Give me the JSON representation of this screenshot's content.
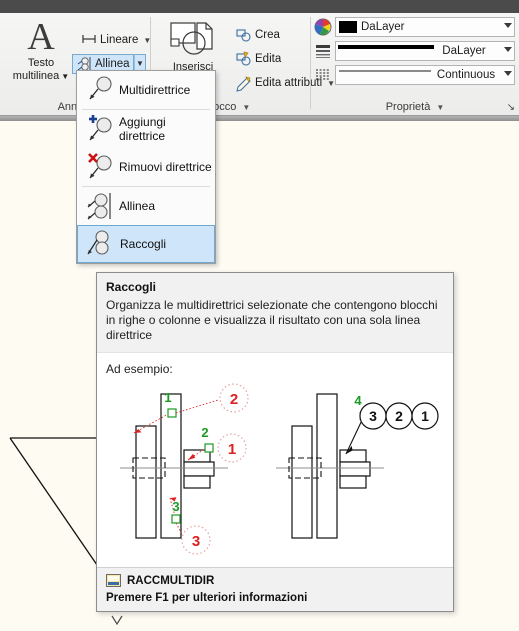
{
  "window": {
    "titlebar_color": "#4b4b4b"
  },
  "ribbon": {
    "panels": [
      {
        "label": "Annota",
        "caret": "▼"
      },
      {
        "label": "locco",
        "caret": "▼"
      },
      {
        "label": "Proprietà",
        "caret": "▼"
      }
    ],
    "annotation_panel": {
      "mtext_glyph": "A",
      "mtext_line1": "Testo",
      "mtext_line2": "multilinea",
      "mtext_caret": "▼",
      "linear_label": "Lineare",
      "linear_caret": "▼",
      "allinea_label": "Allinea",
      "allinea_caret": "▼"
    },
    "block_panel": {
      "insert_label": "Inserisci",
      "create_label": "Crea",
      "edit_label": "Edita",
      "edit_attributes_label": "Edita attributi",
      "edit_attributes_caret": "▼"
    },
    "properties_panel": {
      "color_value": "DaLayer",
      "color_swatch": "#000000",
      "lineweight_value": "DaLayer",
      "linetype_value": "Continuous",
      "dropdown_caret": "▼",
      "dialog_launcher": "↘"
    }
  },
  "menu": {
    "items": [
      {
        "label": "Multidirettrice",
        "icon": "leader-icon",
        "selected": false
      },
      {
        "label": "Aggiungi direttrice",
        "icon": "leader-add-icon",
        "selected": false
      },
      {
        "label": "Rimuovi direttrice",
        "icon": "leader-remove-icon",
        "selected": false
      },
      {
        "label": "Allinea",
        "icon": "leader-align-icon",
        "selected": false
      },
      {
        "label": "Raccogli",
        "icon": "leader-collect-icon",
        "selected": true
      }
    ]
  },
  "tooltip": {
    "title": "Raccogli",
    "description": "Organizza le multidirettrici selezionate che contengono blocchi in righe o colonne e visualizza il risultato con una sola linea direttrice",
    "example_label": "Ad esempio:",
    "command_name": "RACCMULTIDIR",
    "help_hint": "Premere F1 per ulteriori informazioni",
    "illustration": {
      "before_order_labels": [
        "1",
        "2",
        "3"
      ],
      "before_balloon_labels": [
        "2",
        "1",
        "3"
      ],
      "after_order_label": "4",
      "after_balloon_labels": [
        "3",
        "2",
        "1"
      ],
      "order_color": "#1a9a23",
      "balloon_color": "#e02020"
    }
  }
}
